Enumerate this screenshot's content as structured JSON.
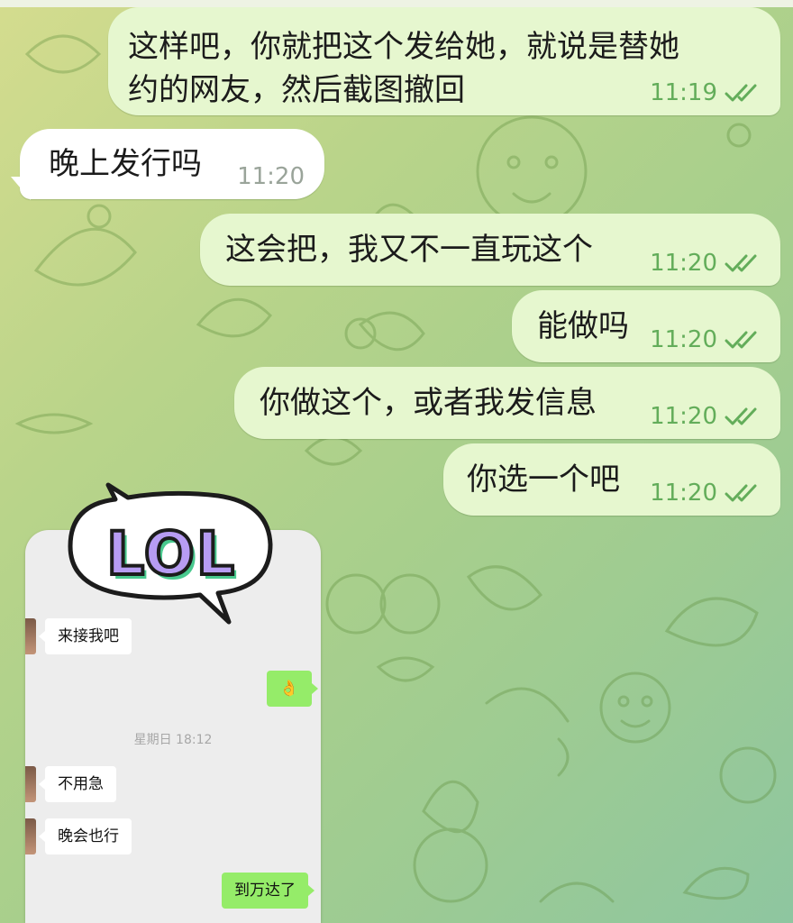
{
  "colors": {
    "outgoing_bubble": "#e6f7cf",
    "incoming_bubble": "#ffffff",
    "read_check": "#63ad5a",
    "wallpaper_start": "#d4dc8e",
    "wallpaper_end": "#8ec6a0"
  },
  "messages": [
    {
      "direction": "out",
      "text": "这样吧，你就把这个发给她，就说是替她\n约的网友，然后截图撤回",
      "time": "11:19",
      "status": "read"
    },
    {
      "direction": "in",
      "text": "晚上发行吗",
      "time": "11:20"
    },
    {
      "direction": "out",
      "text": "这会把，我又不一直玩这个",
      "time": "11:20",
      "status": "read"
    },
    {
      "direction": "out",
      "text": "能做吗",
      "time": "11:20",
      "status": "read"
    },
    {
      "direction": "out",
      "text": "你做这个，或者我发信息",
      "time": "11:20",
      "status": "read"
    },
    {
      "direction": "out",
      "text": "你选一个吧",
      "time": "11:20",
      "status": "read"
    }
  ],
  "image_message": {
    "sticker_text": "LOL",
    "screenshot": {
      "items": [
        {
          "side": "left",
          "text": "来接我吧"
        },
        {
          "side": "right",
          "text": "👌"
        },
        {
          "type": "timestamp",
          "text": "星期日 18:12"
        },
        {
          "side": "left",
          "text": "不用急"
        },
        {
          "side": "left",
          "text": "晚会也行"
        },
        {
          "side": "right",
          "text": "到万达了"
        }
      ]
    }
  },
  "icons": {
    "read_receipt": "double-check-icon"
  }
}
